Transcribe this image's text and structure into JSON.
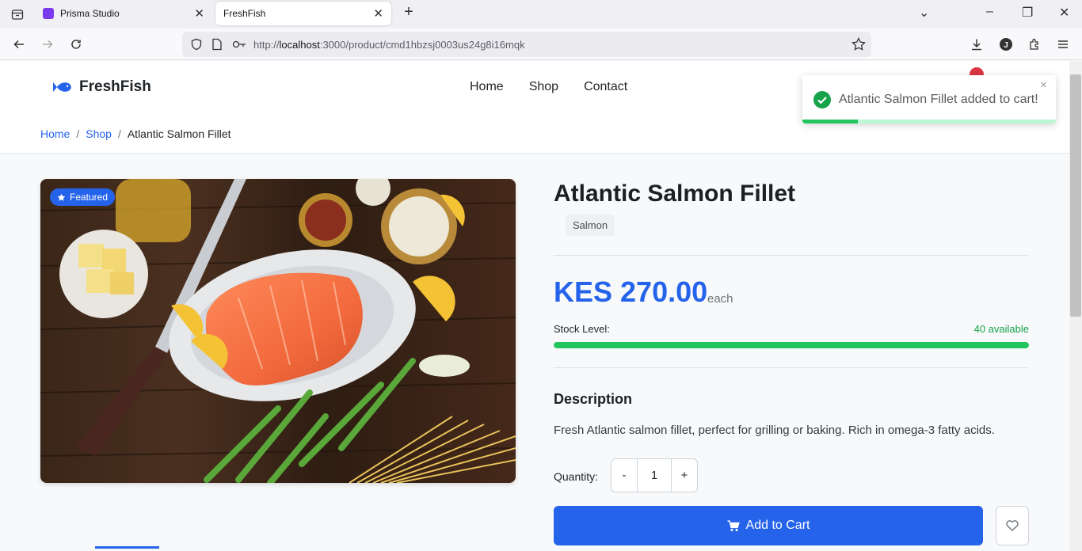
{
  "browser": {
    "tabs": [
      {
        "title": "Prisma Studio",
        "active": false
      },
      {
        "title": "FreshFish",
        "active": true
      }
    ],
    "url": {
      "host": "localhost",
      "rest": ":3000/product/cmd1hbzsj0003us24g8i16mqk",
      "scheme": "http://"
    }
  },
  "site": {
    "brand": "FreshFish",
    "nav": [
      "Home",
      "Shop",
      "Contact"
    ]
  },
  "breadcrumb": {
    "home": "Home",
    "shop": "Shop",
    "current": "Atlantic Salmon Fillet"
  },
  "product": {
    "badge": "Featured",
    "title": "Atlantic Salmon Fillet",
    "category": "Salmon",
    "price": "KES 270.00",
    "unit": "each",
    "stock_label": "Stock Level:",
    "stock_available": "40 available",
    "stock_fraction": 1.0,
    "description_heading": "Description",
    "description": "Fresh Atlantic salmon fillet, perfect for grilling or baking. Rich in omega-3 fatty acids.",
    "quantity_label": "Quantity:",
    "quantity": "1",
    "minus": "-",
    "plus": "+",
    "add_to_cart": "Add to Cart"
  },
  "toast": {
    "message": "Atlantic Salmon Fillet added to cart!",
    "close": "×",
    "progress_fraction": 0.22
  },
  "colors": {
    "accent": "#2563eb",
    "success": "#22c55e"
  }
}
